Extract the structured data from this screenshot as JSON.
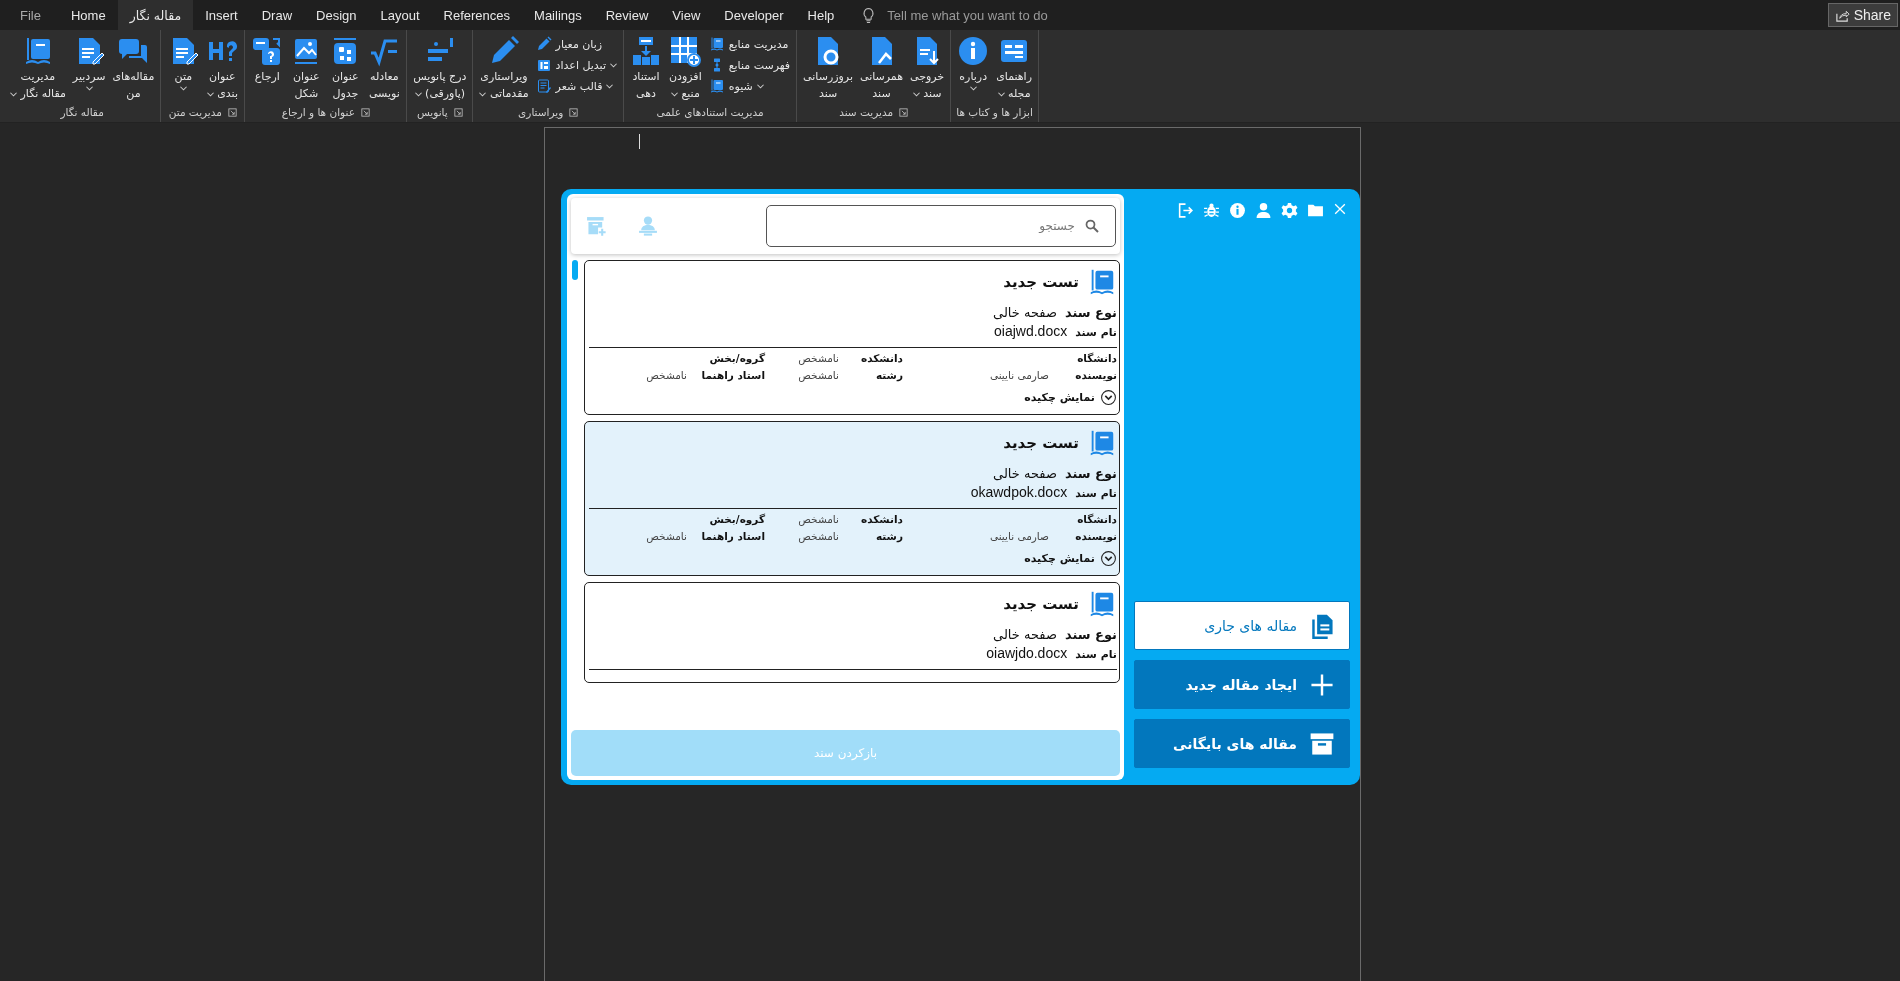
{
  "tabs": [
    {
      "label": "Help",
      "selected": false,
      "kind": "tab"
    },
    {
      "label": "Developer",
      "selected": false,
      "kind": "tab"
    },
    {
      "label": "View",
      "selected": false,
      "kind": "tab"
    },
    {
      "label": "Review",
      "selected": false,
      "kind": "tab"
    },
    {
      "label": "Mailings",
      "selected": false,
      "kind": "tab"
    },
    {
      "label": "References",
      "selected": false,
      "kind": "tab"
    },
    {
      "label": "Layout",
      "selected": false,
      "kind": "tab"
    },
    {
      "label": "Design",
      "selected": false,
      "kind": "tab"
    },
    {
      "label": "Draw",
      "selected": false,
      "kind": "tab"
    },
    {
      "label": "Insert",
      "selected": false,
      "kind": "tab"
    },
    {
      "label": "مقاله نگار",
      "selected": true,
      "kind": "tab"
    },
    {
      "label": "Home",
      "selected": false,
      "kind": "tab"
    },
    {
      "label": "File",
      "selected": false,
      "kind": "file"
    }
  ],
  "tell_me": {
    "placeholder": "Tell me what you want to do"
  },
  "share_button": {
    "label": "Share"
  },
  "ribbon": {
    "groups": [
      {
        "label": "ابزار ها و کتاب ها",
        "launcher": false,
        "items": [
          {
            "kind": "large",
            "lines": [
              "راهنمای",
              "مجله"
            ],
            "dropdown": true
          },
          {
            "kind": "large",
            "lines": [
              "درباره"
            ],
            "dropdown": true
          }
        ]
      },
      {
        "label": "مدیریت سند",
        "launcher": true,
        "items": [
          {
            "kind": "large",
            "lines": [
              "خروجی",
              "سند"
            ],
            "dropdown": true
          },
          {
            "kind": "large",
            "lines": [
              "همرسانی",
              "سند"
            ],
            "dropdown": false
          },
          {
            "kind": "large",
            "lines": [
              "بروزرسانی",
              "سند"
            ],
            "dropdown": false
          }
        ]
      },
      {
        "label": "مدیریت استنادهای علمی",
        "launcher": false,
        "items": [
          {
            "kind": "stack",
            "children": [
              {
                "label": "مدیریت منابع",
                "dropdown": false
              },
              {
                "label": "فهرست منابع",
                "dropdown": false
              },
              {
                "label": "شیوه",
                "dropdown": true
              }
            ]
          },
          {
            "kind": "large",
            "lines": [
              "افزودن",
              "منبع"
            ],
            "dropdown": true
          },
          {
            "kind": "large",
            "lines": [
              "استناد",
              "دهی"
            ],
            "dropdown": false
          }
        ]
      },
      {
        "label": "ویراستاری",
        "launcher": true,
        "items": [
          {
            "kind": "stack",
            "children": [
              {
                "label": "زبان معیار",
                "dropdown": false
              },
              {
                "label": "تبدیل اعداد",
                "dropdown": true
              },
              {
                "label": "قالب شعر",
                "dropdown": true
              }
            ]
          },
          {
            "kind": "large",
            "lines": [
              "ویراستاری",
              "مقدماتی"
            ],
            "dropdown": true
          }
        ]
      },
      {
        "label": "پانویس",
        "launcher": true,
        "items": [
          {
            "kind": "large",
            "lines": [
              "درج پانویس",
              "(پاورقی)"
            ],
            "dropdown": true
          }
        ]
      },
      {
        "label": "عنوان ها و ارجاع",
        "launcher": true,
        "items": [
          {
            "kind": "large",
            "lines": [
              "معادله",
              "نویسی"
            ],
            "dropdown": false
          },
          {
            "kind": "large",
            "lines": [
              "عنوان",
              "جدول"
            ],
            "dropdown": false
          },
          {
            "kind": "large",
            "lines": [
              "عنوان",
              "شکل"
            ],
            "dropdown": false
          },
          {
            "kind": "large",
            "lines": [
              "ارجاع"
            ],
            "dropdown": false
          }
        ]
      },
      {
        "label": "مدیریت متن",
        "launcher": true,
        "items": [
          {
            "kind": "large",
            "lines": [
              "عنوان",
              "بندی"
            ],
            "dropdown": true
          },
          {
            "kind": "large",
            "lines": [
              "متن"
            ],
            "dropdown": true
          }
        ]
      },
      {
        "label": "مقاله نگار",
        "launcher": false,
        "items": [
          {
            "kind": "large",
            "lines": [
              "مقاله‌های",
              "من"
            ],
            "dropdown": false
          },
          {
            "kind": "large",
            "lines": [
              "سردبیر"
            ],
            "dropdown": true
          },
          {
            "kind": "large",
            "lines": [
              "مدیریت",
              "مقاله نگار"
            ],
            "dropdown": true
          }
        ]
      }
    ]
  },
  "panel": {
    "search": {
      "placeholder": "جستجو"
    },
    "documents": [
      {
        "title": "تست جدید",
        "selected": false,
        "doc_type": {
          "label": "نوع سند",
          "value": "صفحه خالی"
        },
        "doc_name": {
          "label": "نام سند",
          "value": "oiajwd.docx"
        },
        "info": [
          {
            "label": "دانشگاه"
          },
          {
            "label": "دانشکده",
            "value": "نامشخص"
          },
          {
            "label": "گروه/بخش"
          },
          {
            "label": "نویسنده",
            "value": "صارمی نایینی"
          },
          {
            "label": "رشته",
            "value": "نامشخص"
          },
          {
            "label": "استاد راهنما",
            "value": "نامشخص"
          }
        ],
        "abstract_toggle": "نمایش چکیده"
      },
      {
        "title": "تست جدید",
        "selected": true,
        "doc_type": {
          "label": "نوع سند",
          "value": "صفحه خالی"
        },
        "doc_name": {
          "label": "نام سند",
          "value": "okawdpok.docx"
        },
        "info": [
          {
            "label": "دانشگاه"
          },
          {
            "label": "دانشکده",
            "value": "نامشخص"
          },
          {
            "label": "گروه/بخش"
          },
          {
            "label": "نویسنده",
            "value": "صارمی نایینی"
          },
          {
            "label": "رشته",
            "value": "نامشخص"
          },
          {
            "label": "استاد راهنما",
            "value": "نامشخص"
          }
        ],
        "abstract_toggle": "نمایش چکیده"
      },
      {
        "title": "تست جدید",
        "selected": false,
        "doc_type": {
          "label": "نوع سند",
          "value": "صفحه خالی"
        },
        "doc_name": {
          "label": "نام سند",
          "value": "oiawjdo.docx"
        }
      }
    ],
    "restore_button": {
      "label": "بازکردن سند",
      "disabled": true
    },
    "sidebar": {
      "nav": [
        {
          "label": "مقاله های جاری",
          "selected": true,
          "kind": "current"
        },
        {
          "label": "ایجاد مقاله جدید",
          "selected": false,
          "kind": "new"
        },
        {
          "label": "مقاله های بایگانی",
          "selected": false,
          "kind": "archive"
        }
      ]
    }
  }
}
